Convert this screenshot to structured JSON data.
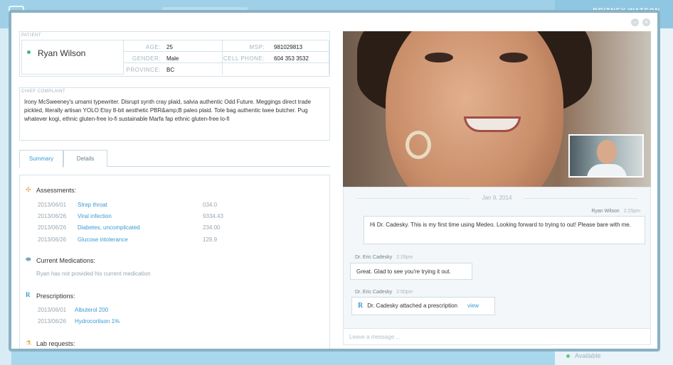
{
  "background": {
    "username": "BRITNEY WATSON",
    "availability": "Available"
  },
  "modal": {
    "minimize_glyph": "–",
    "close_glyph": "×"
  },
  "patient": {
    "section_label": "PATIENT",
    "name": "Ryan Wilson",
    "status_color": "#41b882",
    "fields": {
      "age_label": "AGE:",
      "age": "25",
      "msp_label": "MSP:",
      "msp": "981029813",
      "gender_label": "GENDER:",
      "gender": "Male",
      "cell_label": "CELL PHONE:",
      "cell": "604 353 3532",
      "province_label": "PROVINCE:",
      "province": "BC"
    }
  },
  "complaint": {
    "section_label": "CHIEF COMPLAINT",
    "text": "Irony McSweeney's umami typewriter.  Disrupt synth cray plaid, salvia authentic Odd Future.  Meggings direct trade  pickled, literally artisan YOLO Etsy 8-bit aesthetic PBR&amp;B paleo plaid.  Tote bag authentic twee butcher.  Pug whatever kogi, ethnic gluten-free lo-fi sustainable Marfa fap ethnic gluten-free lo-fi"
  },
  "tabs": [
    {
      "label": "Summary",
      "active": true
    },
    {
      "label": "Details",
      "active": false
    }
  ],
  "summary": {
    "assessments": {
      "title": "Assessments:",
      "icon": "assessment-icon",
      "items": [
        {
          "date": "2013/06/01",
          "label": "Strep throat",
          "code": "034.0"
        },
        {
          "date": "2013/06/26",
          "label": "Viral infection",
          "code": "9334.43"
        },
        {
          "date": "2013/06/26",
          "label": "Diabetes, uncomplicated",
          "code": "234.00"
        },
        {
          "date": "2013/06/26",
          "label": "Glucose intolerance",
          "code": "128.9"
        }
      ]
    },
    "medications": {
      "title": "Current Medications:",
      "icon": "pill-icon",
      "empty_text": "Ryan has not provided his current medication"
    },
    "prescriptions": {
      "title": "Prescriptions:",
      "icon": "rx-icon",
      "icon_glyph": "R",
      "items": [
        {
          "date": "2013/06/01",
          "label": "Albuterol 200"
        },
        {
          "date": "2013/06/26",
          "label": "Hydrocortison 1%"
        }
      ]
    },
    "lab": {
      "title": "Lab requests:",
      "icon": "flask-icon"
    }
  },
  "chat": {
    "date": "Jan 9, 2014",
    "messages": [
      {
        "author": "Ryan Wilson",
        "time": "2:25pm",
        "text": "Hi Dr. Cadesky. This is my first time using Medeo. Looking forward to trying to out! Please bare with me."
      },
      {
        "author": "Dr. Eric Cadesky",
        "time": "2:26pm",
        "text": "Great. Glad to see you're trying it out."
      },
      {
        "author": "Dr. Eric Cadesky",
        "time": "2:50pm",
        "text": "Dr. Cadesky attached a prescription",
        "rx_glyph": "R",
        "link": "view"
      }
    ],
    "input_placeholder": "Leave a message ..."
  },
  "colors": {
    "accent": "#3a9bd2",
    "status_available": "#41b882",
    "modal_border": "#8ab1c4"
  }
}
